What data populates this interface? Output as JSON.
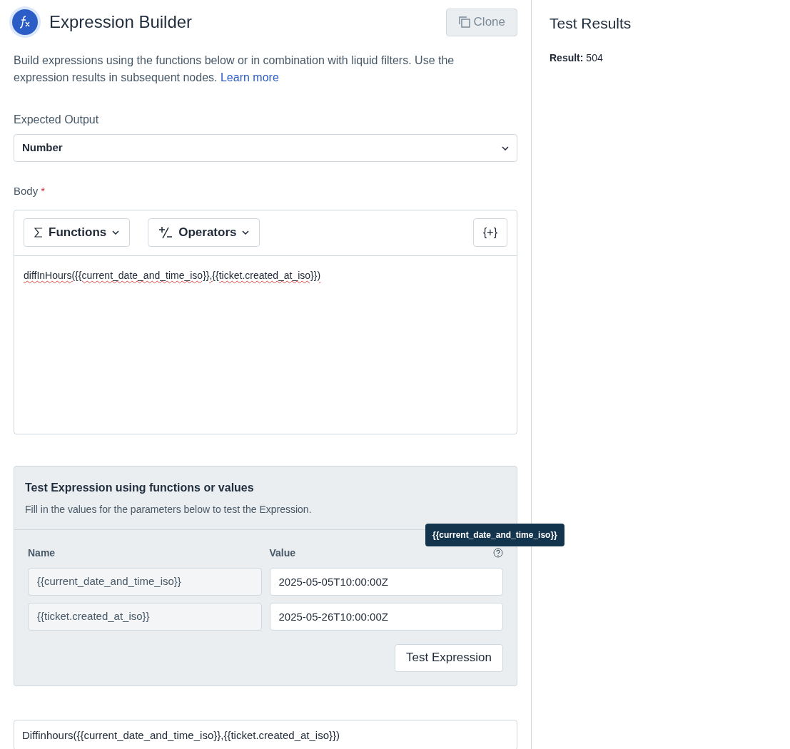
{
  "header": {
    "title": "Expression Builder",
    "clone_button": {
      "label": "Clone",
      "disabled": true
    }
  },
  "description": {
    "text": "Build expressions using the functions below or in combination with liquid filters. Use the expression results in subsequent nodes.",
    "link": "Learn more"
  },
  "expected_output": {
    "label": "Expected Output",
    "value": "Number"
  },
  "body": {
    "label": "Body",
    "required_mark": "*",
    "toolbar": [
      {
        "kind": "sigma",
        "label": "Functions"
      },
      {
        "kind": "plusminus",
        "label": "Operators"
      }
    ],
    "insert_button": "{+}",
    "value": "diffInHours({{current_date_and_time_iso}},{{ticket.created_at_iso}})"
  },
  "test_panel": {
    "title": "Test Expression using functions or values",
    "subtitle": "Fill in the values for the parameters below to test the Expression.",
    "columns": [
      "Name",
      "Value"
    ],
    "rows": [
      {
        "name": "{{current_date_and_time_iso}}",
        "value": "2025-05-05T10:00:00Z"
      },
      {
        "name": "{{ticket.created_at_iso}}",
        "value": "2025-05-26T10:00:00Z"
      }
    ],
    "tooltip": "{{current_date_and_time_iso}}",
    "button": "Test Expression"
  },
  "output_field": {
    "value": "Diffinhours({{current_date_and_time_iso}},{{ticket.created_at_iso}})"
  },
  "results": {
    "title": "Test Results",
    "result": "**Result:** 504"
  }
}
